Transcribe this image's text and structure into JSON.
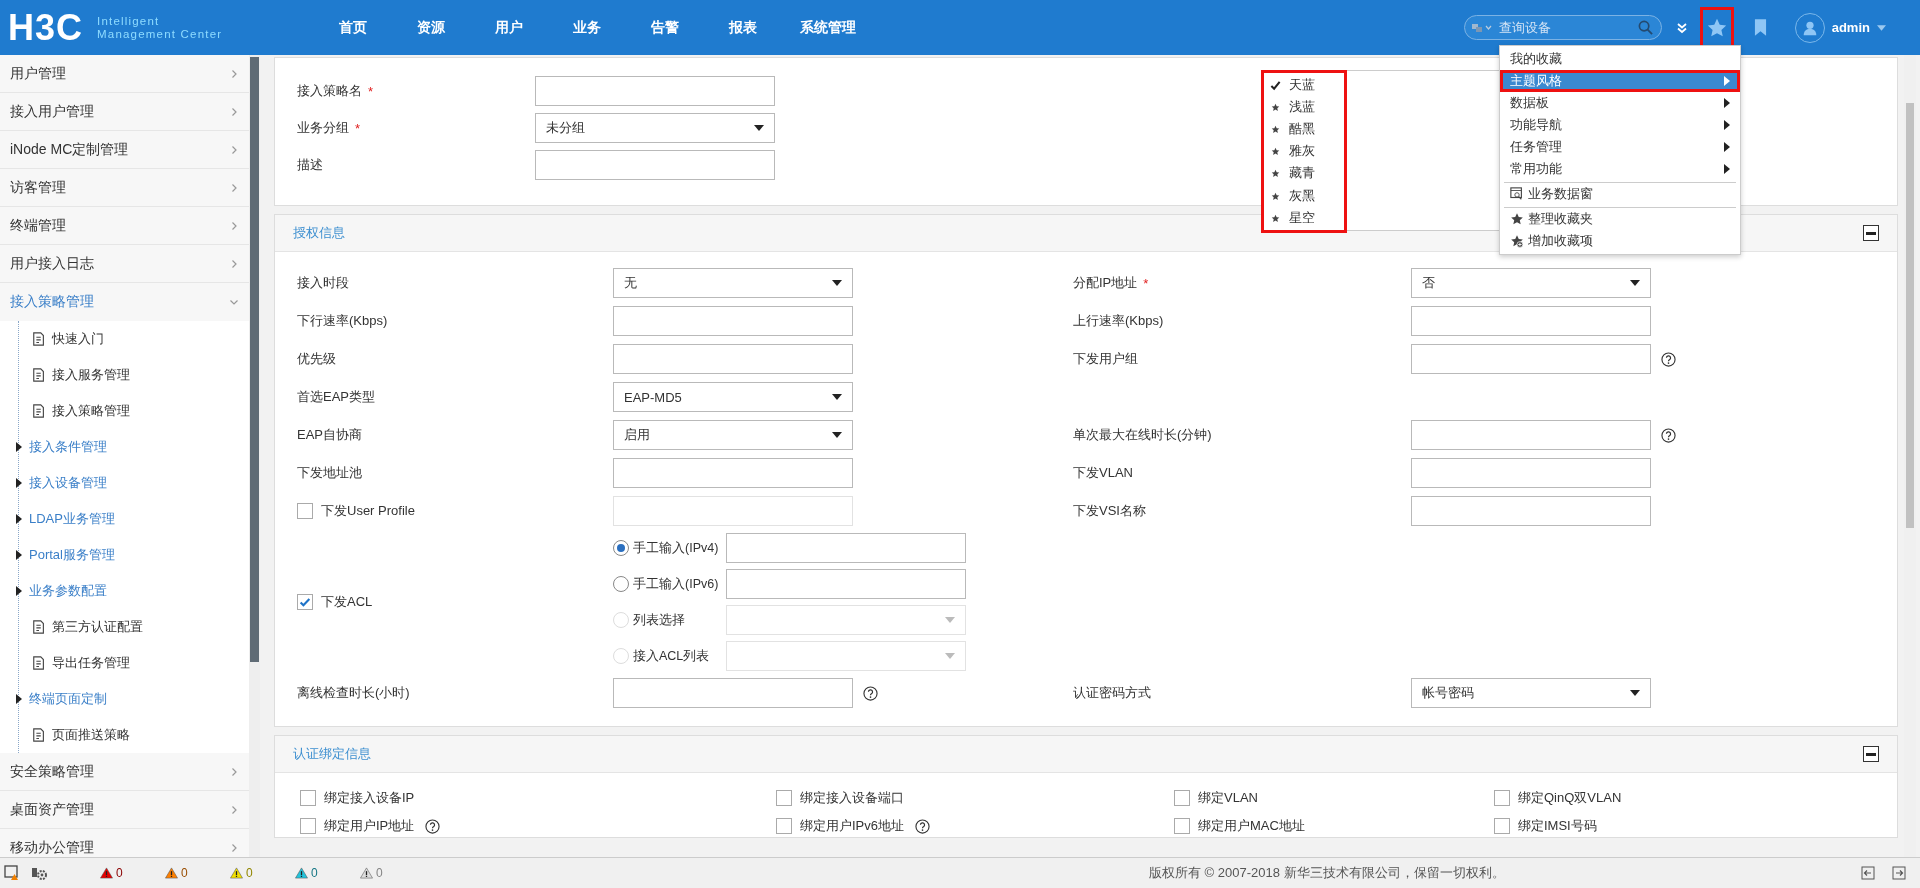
{
  "header": {
    "logo": {
      "brand": "H3C",
      "tagline": [
        "Intelligent",
        "Management Center"
      ]
    },
    "nav": [
      "首页",
      "资源",
      "用户",
      "业务",
      "告警",
      "报表",
      "系统管理"
    ],
    "search": {
      "placeholder": "查询设备"
    },
    "user": "admin"
  },
  "favorites_menu": {
    "groups": [
      [
        {
          "label": "我的收藏",
          "kind": "plain",
          "selected": false
        },
        {
          "label": "主题风格",
          "kind": "submenu",
          "selected": true
        },
        {
          "label": "数据板",
          "kind": "submenu",
          "selected": false
        },
        {
          "label": "功能导航",
          "kind": "submenu",
          "selected": false
        },
        {
          "label": "任务管理",
          "kind": "submenu",
          "selected": false
        },
        {
          "label": "常用功能",
          "kind": "submenu",
          "selected": false
        }
      ],
      [
        {
          "label": "业务数据窗",
          "kind": "action",
          "selected": false
        }
      ],
      [
        {
          "label": "整理收藏夹",
          "kind": "action",
          "selected": false
        },
        {
          "label": "增加收藏项",
          "kind": "action",
          "selected": false
        }
      ]
    ]
  },
  "theme_menu": [
    {
      "label": "天蓝",
      "selected": true
    },
    {
      "label": "浅蓝",
      "selected": false
    },
    {
      "label": "酷黑",
      "selected": false
    },
    {
      "label": "雅灰",
      "selected": false
    },
    {
      "label": "藏青",
      "selected": false
    },
    {
      "label": "灰黑",
      "selected": false
    },
    {
      "label": "星空",
      "selected": false
    }
  ],
  "sidebar": [
    {
      "label": "用户管理",
      "expanded": false
    },
    {
      "label": "接入用户管理",
      "expanded": false
    },
    {
      "label": "iNode MC定制管理",
      "expanded": false
    },
    {
      "label": "访客管理",
      "expanded": false
    },
    {
      "label": "终端管理",
      "expanded": false
    },
    {
      "label": "用户接入日志",
      "expanded": false
    },
    {
      "label": "接入策略管理",
      "expanded": true,
      "children": [
        {
          "label": "快速入门",
          "kind": "page"
        },
        {
          "label": "接入服务管理",
          "kind": "page"
        },
        {
          "label": "接入策略管理",
          "kind": "page"
        },
        {
          "label": "接入条件管理",
          "kind": "group"
        },
        {
          "label": "接入设备管理",
          "kind": "group"
        },
        {
          "label": "LDAP业务管理",
          "kind": "group"
        },
        {
          "label": "Portal服务管理",
          "kind": "group"
        },
        {
          "label": "业务参数配置",
          "kind": "group"
        },
        {
          "label": "第三方认证配置",
          "kind": "page"
        },
        {
          "label": "导出任务管理",
          "kind": "page"
        },
        {
          "label": "终端页面定制",
          "kind": "group"
        },
        {
          "label": "页面推送策略",
          "kind": "page"
        }
      ]
    },
    {
      "label": "安全策略管理",
      "expanded": false
    },
    {
      "label": "桌面资产管理",
      "expanded": false
    },
    {
      "label": "移动办公管理",
      "expanded": false
    }
  ],
  "basic": [
    {
      "label": "接入策略名",
      "required_mark": "*",
      "kind": "text"
    },
    {
      "label": "业务分组",
      "required_mark": "*",
      "kind": "select",
      "value": "未分组"
    },
    {
      "label": "描述",
      "kind": "text"
    }
  ],
  "authorization": {
    "title": "授权信息",
    "rows": [
      {
        "kind": "pair",
        "left": {
          "label": "接入时段",
          "kind": "select",
          "value": "无"
        },
        "right": {
          "label": "分配IP地址",
          "required_mark": "*",
          "kind": "select",
          "value": "否"
        }
      },
      {
        "kind": "pair",
        "left": {
          "label": "下行速率(Kbps)",
          "kind": "text"
        },
        "right": {
          "label": "上行速率(Kbps)",
          "kind": "text"
        }
      },
      {
        "kind": "pair",
        "left": {
          "label": "优先级",
          "kind": "text"
        },
        "right": {
          "label": "下发用户组",
          "kind": "text",
          "help": true
        }
      },
      {
        "kind": "pair",
        "left": {
          "label": "首选EAP类型",
          "kind": "select",
          "value": "EAP-MD5"
        }
      },
      {
        "kind": "pair",
        "left": {
          "label": "EAP自协商",
          "kind": "select",
          "value": "启用"
        },
        "right": {
          "label": "单次最大在线时长(分钟)",
          "kind": "text",
          "help": true
        }
      },
      {
        "kind": "pair",
        "left": {
          "label": "下发地址池",
          "kind": "text"
        },
        "right": {
          "label": "下发VLAN",
          "kind": "text"
        }
      },
      {
        "kind": "pair",
        "left": {
          "label": "下发User Profile",
          "kind": "text",
          "checked": false,
          "disabled": true
        },
        "right": {
          "label": "下发VSI名称",
          "kind": "text"
        }
      },
      {
        "kind": "acl",
        "label": "下发ACL",
        "checked": true,
        "options": [
          {
            "label": "手工输入(IPv4)",
            "kind": "text",
            "selected": true,
            "disabled": false
          },
          {
            "label": "手工输入(IPv6)",
            "kind": "text",
            "selected": false,
            "disabled": false
          },
          {
            "label": "列表选择",
            "kind": "select",
            "selected": false,
            "disabled": true
          },
          {
            "label": "接入ACL列表",
            "kind": "select",
            "selected": false,
            "disabled": true
          }
        ]
      },
      {
        "kind": "pair",
        "left": {
          "label": "离线检查时长(小时)",
          "kind": "text",
          "help": true
        },
        "right": {
          "label": "认证密码方式",
          "kind": "select",
          "value": "帐号密码"
        }
      }
    ]
  },
  "binding": {
    "title": "认证绑定信息",
    "rows": [
      [
        {
          "label": "绑定接入设备IP",
          "checked": false
        },
        {
          "label": "绑定接入设备端口",
          "checked": false
        },
        {
          "label": "绑定VLAN",
          "checked": false
        },
        {
          "label": "绑定QinQ双VLAN",
          "checked": false
        }
      ],
      [
        {
          "label": "绑定用户IP地址",
          "checked": false,
          "help": true
        },
        {
          "label": "绑定用户IPv6地址",
          "checked": false,
          "help": true
        },
        {
          "label": "绑定用户MAC地址",
          "checked": false
        },
        {
          "label": "绑定IMSI号码",
          "checked": false
        }
      ]
    ]
  },
  "status_bar": {
    "alerts": [
      {
        "count": "0",
        "color": "#e60000"
      },
      {
        "count": "0",
        "color": "#ff8000"
      },
      {
        "count": "0",
        "color": "#f2e000"
      },
      {
        "count": "0",
        "color": "#22c4dc"
      },
      {
        "count": "0",
        "color": "#dddddd"
      }
    ],
    "copyright": "版权所有 © 2007-2018 新华三技术有限公司，保留一切权利。"
  }
}
